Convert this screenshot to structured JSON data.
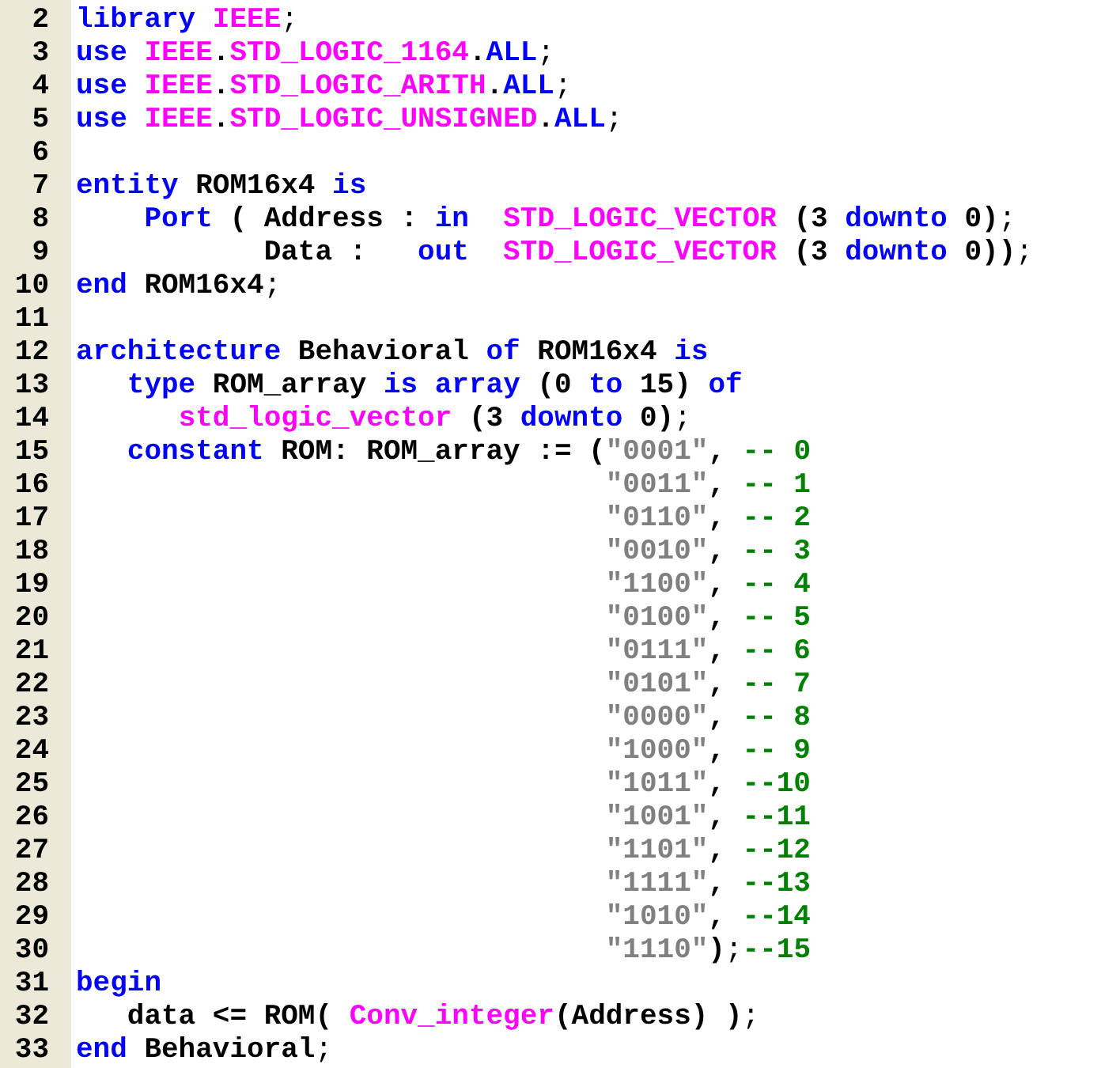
{
  "lines": [
    {
      "number": "2",
      "tokens": [
        {
          "kind": "keyword",
          "text": "library"
        },
        {
          "kind": "library",
          "text": " IEEE"
        },
        {
          "kind": "punct",
          "text": ";"
        }
      ]
    },
    {
      "number": "3",
      "tokens": [
        {
          "kind": "keyword",
          "text": "use"
        },
        {
          "kind": "library",
          "text": " IEEE"
        },
        {
          "kind": "plain",
          "text": "."
        },
        {
          "kind": "library",
          "text": "STD_LOGIC_1164"
        },
        {
          "kind": "plain",
          "text": "."
        },
        {
          "kind": "keyword",
          "text": "ALL"
        },
        {
          "kind": "punct",
          "text": ";"
        }
      ]
    },
    {
      "number": "4",
      "tokens": [
        {
          "kind": "keyword",
          "text": "use"
        },
        {
          "kind": "library",
          "text": " IEEE"
        },
        {
          "kind": "plain",
          "text": "."
        },
        {
          "kind": "library",
          "text": "STD_LOGIC_ARITH"
        },
        {
          "kind": "plain",
          "text": "."
        },
        {
          "kind": "keyword",
          "text": "ALL"
        },
        {
          "kind": "punct",
          "text": ";"
        }
      ]
    },
    {
      "number": "5",
      "tokens": [
        {
          "kind": "keyword",
          "text": "use"
        },
        {
          "kind": "library",
          "text": " IEEE"
        },
        {
          "kind": "plain",
          "text": "."
        },
        {
          "kind": "library",
          "text": "STD_LOGIC_UNSIGNED"
        },
        {
          "kind": "plain",
          "text": "."
        },
        {
          "kind": "keyword",
          "text": "ALL"
        },
        {
          "kind": "punct",
          "text": ";"
        }
      ]
    },
    {
      "number": "6"
    },
    {
      "number": "7",
      "tokens": [
        {
          "kind": "keyword",
          "text": "entity"
        },
        {
          "kind": "plain",
          "text": " ROM16x4 "
        },
        {
          "kind": "keyword",
          "text": "is"
        }
      ]
    },
    {
      "number": "8",
      "tokens": [
        {
          "kind": "keyword",
          "text": "    Port"
        },
        {
          "kind": "plain",
          "text": " ( Address : "
        },
        {
          "kind": "keyword",
          "text": "in"
        },
        {
          "kind": "library",
          "text": "  STD_LOGIC_VECTOR"
        },
        {
          "kind": "plain",
          "text": " (3 "
        },
        {
          "kind": "keyword",
          "text": "downto"
        },
        {
          "kind": "plain",
          "text": " 0)"
        },
        {
          "kind": "punct",
          "text": ";"
        }
      ]
    },
    {
      "number": "9",
      "tokens": [
        {
          "kind": "plain",
          "text": "           Data :   "
        },
        {
          "kind": "keyword",
          "text": "out"
        },
        {
          "kind": "library",
          "text": "  STD_LOGIC_VECTOR"
        },
        {
          "kind": "plain",
          "text": " (3 "
        },
        {
          "kind": "keyword",
          "text": "downto"
        },
        {
          "kind": "plain",
          "text": " 0))"
        },
        {
          "kind": "punct",
          "text": ";"
        }
      ]
    },
    {
      "number": "10",
      "tokens": [
        {
          "kind": "keyword",
          "text": "end"
        },
        {
          "kind": "plain",
          "text": " ROM16x4"
        },
        {
          "kind": "punct",
          "text": ";"
        }
      ]
    },
    {
      "number": "11"
    },
    {
      "number": "12",
      "tokens": [
        {
          "kind": "keyword",
          "text": "architecture"
        },
        {
          "kind": "plain",
          "text": " Behavioral "
        },
        {
          "kind": "keyword",
          "text": "of"
        },
        {
          "kind": "plain",
          "text": " ROM16x4 "
        },
        {
          "kind": "keyword",
          "text": "is"
        }
      ]
    },
    {
      "number": "13",
      "tokens": [
        {
          "kind": "keyword",
          "text": "   type"
        },
        {
          "kind": "plain",
          "text": " ROM_array "
        },
        {
          "kind": "keyword",
          "text": "is"
        },
        {
          "kind": "keyword",
          "text": " array"
        },
        {
          "kind": "plain",
          "text": " (0 "
        },
        {
          "kind": "keyword",
          "text": "to"
        },
        {
          "kind": "plain",
          "text": " 15) "
        },
        {
          "kind": "keyword",
          "text": "of"
        }
      ]
    },
    {
      "number": "14",
      "tokens": [
        {
          "kind": "library",
          "text": "      std_logic_vector"
        },
        {
          "kind": "plain",
          "text": " (3 "
        },
        {
          "kind": "keyword",
          "text": "downto"
        },
        {
          "kind": "plain",
          "text": " 0)"
        },
        {
          "kind": "punct",
          "text": ";"
        }
      ]
    },
    {
      "number": "15",
      "tokens": [
        {
          "kind": "keyword",
          "text": "   constant"
        },
        {
          "kind": "plain",
          "text": " ROM: ROM_array := ("
        },
        {
          "kind": "string",
          "text": "\"0001\""
        },
        {
          "kind": "plain",
          "text": ", "
        },
        {
          "kind": "comment",
          "text": "-- 0"
        }
      ]
    },
    {
      "number": "16",
      "tokens": [
        {
          "kind": "string",
          "text": "                               \"0011\""
        },
        {
          "kind": "plain",
          "text": ", "
        },
        {
          "kind": "comment",
          "text": "-- 1"
        }
      ]
    },
    {
      "number": "17",
      "tokens": [
        {
          "kind": "string",
          "text": "                               \"0110\""
        },
        {
          "kind": "plain",
          "text": ", "
        },
        {
          "kind": "comment",
          "text": "-- 2"
        }
      ]
    },
    {
      "number": "18",
      "tokens": [
        {
          "kind": "string",
          "text": "                               \"0010\""
        },
        {
          "kind": "plain",
          "text": ", "
        },
        {
          "kind": "comment",
          "text": "-- 3"
        }
      ]
    },
    {
      "number": "19",
      "tokens": [
        {
          "kind": "string",
          "text": "                               \"1100\""
        },
        {
          "kind": "plain",
          "text": ", "
        },
        {
          "kind": "comment",
          "text": "-- 4"
        }
      ]
    },
    {
      "number": "20",
      "tokens": [
        {
          "kind": "string",
          "text": "                               \"0100\""
        },
        {
          "kind": "plain",
          "text": ", "
        },
        {
          "kind": "comment",
          "text": "-- 5"
        }
      ]
    },
    {
      "number": "21",
      "tokens": [
        {
          "kind": "string",
          "text": "                               \"0111\""
        },
        {
          "kind": "plain",
          "text": ", "
        },
        {
          "kind": "comment",
          "text": "-- 6"
        }
      ]
    },
    {
      "number": "22",
      "tokens": [
        {
          "kind": "string",
          "text": "                               \"0101\""
        },
        {
          "kind": "plain",
          "text": ", "
        },
        {
          "kind": "comment",
          "text": "-- 7"
        }
      ]
    },
    {
      "number": "23",
      "tokens": [
        {
          "kind": "string",
          "text": "                               \"0000\""
        },
        {
          "kind": "plain",
          "text": ", "
        },
        {
          "kind": "comment",
          "text": "-- 8"
        }
      ]
    },
    {
      "number": "24",
      "tokens": [
        {
          "kind": "string",
          "text": "                               \"1000\""
        },
        {
          "kind": "plain",
          "text": ", "
        },
        {
          "kind": "comment",
          "text": "-- 9"
        }
      ]
    },
    {
      "number": "25",
      "tokens": [
        {
          "kind": "string",
          "text": "                               \"1011\""
        },
        {
          "kind": "plain",
          "text": ", "
        },
        {
          "kind": "comment",
          "text": "--10"
        }
      ]
    },
    {
      "number": "26",
      "tokens": [
        {
          "kind": "string",
          "text": "                               \"1001\""
        },
        {
          "kind": "plain",
          "text": ", "
        },
        {
          "kind": "comment",
          "text": "--11"
        }
      ]
    },
    {
      "number": "27",
      "tokens": [
        {
          "kind": "string",
          "text": "                               \"1101\""
        },
        {
          "kind": "plain",
          "text": ", "
        },
        {
          "kind": "comment",
          "text": "--12"
        }
      ]
    },
    {
      "number": "28",
      "tokens": [
        {
          "kind": "string",
          "text": "                               \"1111\""
        },
        {
          "kind": "plain",
          "text": ", "
        },
        {
          "kind": "comment",
          "text": "--13"
        }
      ]
    },
    {
      "number": "29",
      "tokens": [
        {
          "kind": "string",
          "text": "                               \"1010\""
        },
        {
          "kind": "plain",
          "text": ", "
        },
        {
          "kind": "comment",
          "text": "--14"
        }
      ]
    },
    {
      "number": "30",
      "tokens": [
        {
          "kind": "string",
          "text": "                               \"1110\""
        },
        {
          "kind": "plain",
          "text": ")"
        },
        {
          "kind": "punct",
          "text": ";"
        },
        {
          "kind": "comment",
          "text": "--15"
        }
      ]
    },
    {
      "number": "31",
      "tokens": [
        {
          "kind": "keyword",
          "text": "begin"
        }
      ]
    },
    {
      "number": "32",
      "tokens": [
        {
          "kind": "plain",
          "text": "   data <= ROM( "
        },
        {
          "kind": "library",
          "text": "Conv_integer"
        },
        {
          "kind": "plain",
          "text": "(Address) )"
        },
        {
          "kind": "punct",
          "text": ";"
        }
      ]
    },
    {
      "number": "33",
      "tokens": [
        {
          "kind": "keyword",
          "text": "end"
        },
        {
          "kind": "plain",
          "text": " Behavioral"
        },
        {
          "kind": "punct",
          "text": ";"
        }
      ]
    }
  ]
}
